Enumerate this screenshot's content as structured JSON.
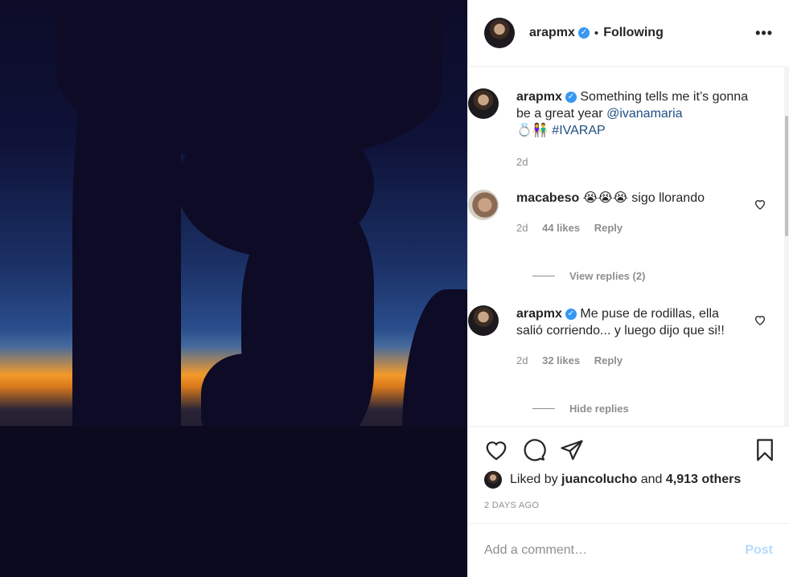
{
  "header": {
    "username": "arapmx",
    "dot": "•",
    "follow_label": "Following",
    "more_icon": "•••"
  },
  "caption": {
    "username": "arapmx",
    "text": "Something tells me it’s gonna be a great year",
    "mention": "@ivanamaria",
    "emojis": "💍👫",
    "hashtag": "#IVARAP",
    "time": "2d"
  },
  "comment1": {
    "username": "macabeso",
    "emojis": "😭😭😭",
    "text": "sigo llorando",
    "time": "2d",
    "likes": "44 likes",
    "reply": "Reply",
    "view_replies": "View replies (2)"
  },
  "comment2": {
    "username": "arapmx",
    "text": "Me puse de rodillas, ella salió corriendo... y luego dijo que si!!",
    "time": "2d",
    "likes": "32 likes",
    "reply": "Reply",
    "hide_replies": "Hide replies"
  },
  "liked": {
    "prefix": "Liked by",
    "user": "juancolucho",
    "and": "and",
    "others": "4,913 others"
  },
  "time_ago": "2 DAYS AGO",
  "add_comment": {
    "placeholder": "Add a comment…",
    "post": "Post"
  },
  "colors": {
    "verified": "#3897f0",
    "link": "#1f4f82",
    "post_disabled": "#b3dbff"
  }
}
